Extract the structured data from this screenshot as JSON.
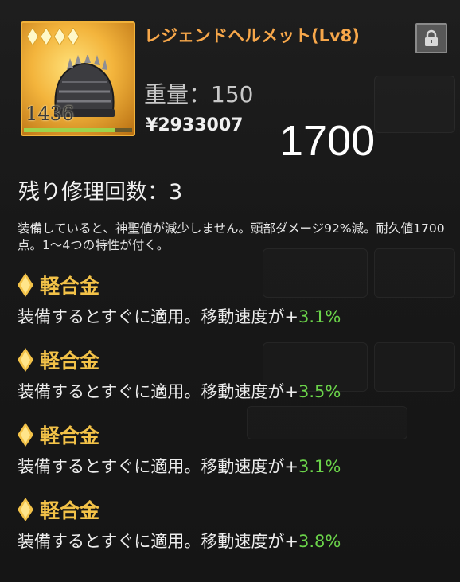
{
  "item": {
    "name": "レジェンドヘルメット(Lv8)",
    "durability_display": "1436",
    "durability_fraction": 0.84,
    "rarity_stars": 4,
    "weight_label": "重量：",
    "weight_value": "150",
    "currency_symbol": "¥",
    "price": "2933007",
    "icon": "helmet-icon"
  },
  "overlay_number": "1700",
  "repair": {
    "label": "残り修理回数：",
    "count": "3"
  },
  "description": "装備していると、神聖値が減少しません。頭部ダメージ92%減。耐久値1700点。1〜4つの特性が付く。",
  "traits": [
    {
      "name": "軽合金",
      "effect": "装備するとすぐに適用。移動速度が",
      "plus": "+",
      "value": "3.1%"
    },
    {
      "name": "軽合金",
      "effect": "装備するとすぐに適用。移動速度が",
      "plus": "+",
      "value": "3.5%"
    },
    {
      "name": "軽合金",
      "effect": "装備するとすぐに適用。移動速度が",
      "plus": "+",
      "value": "3.1%"
    },
    {
      "name": "軽合金",
      "effect": "装備するとすぐに適用。移動速度が",
      "plus": "+",
      "value": "3.8%"
    }
  ],
  "colors": {
    "name": "#f7a74a",
    "trait_name": "#f3c248",
    "trait_value": "#6bd44a",
    "frame": "#f1b23a"
  },
  "lock_icon": "lock-icon"
}
